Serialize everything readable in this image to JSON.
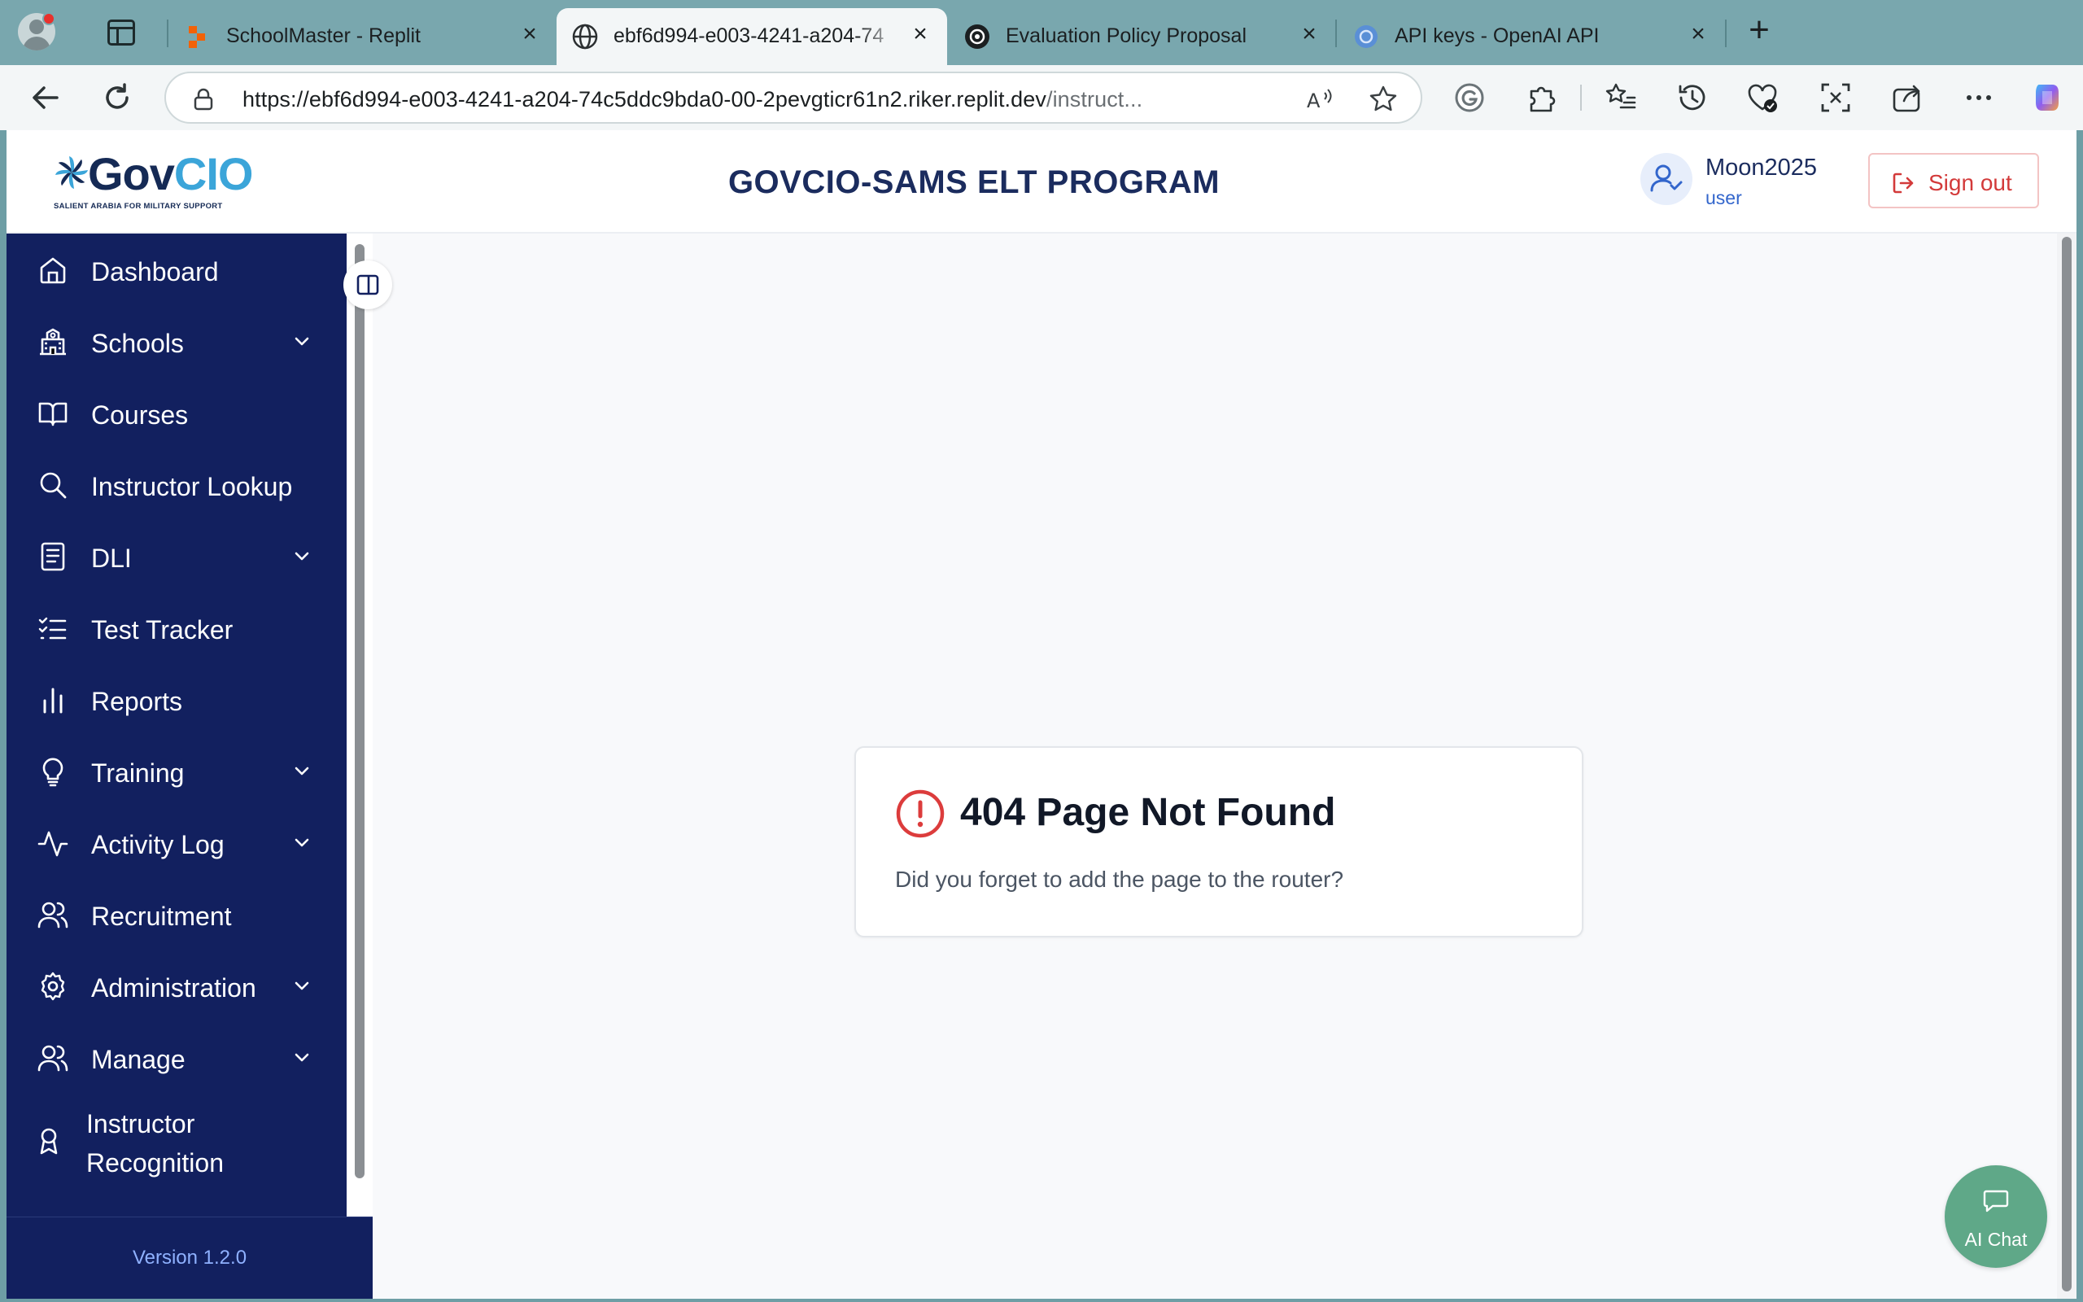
{
  "browser": {
    "tabs": [
      {
        "title": "SchoolMaster - Replit",
        "icon": "replit-icon",
        "active": false
      },
      {
        "title": "ebf6d994-e003-4241-a204-74",
        "icon": "globe-icon",
        "active": true
      },
      {
        "title": "Evaluation Policy Proposal",
        "icon": "openai-icon",
        "active": false
      },
      {
        "title": "API keys - OpenAI API",
        "icon": "openai-api-icon",
        "active": false
      }
    ],
    "url_host": "https://ebf6d994-e003-4241-a204-74c5ddc9bda0-00-2pevgticr61n2.riker.replit.dev",
    "url_path": "/instruct..."
  },
  "header": {
    "logo": "GovCIO",
    "logo_word_1": "Gov",
    "logo_word_2": "CIO",
    "logo_tagline": "SALIENT ARABIA FOR MILITARY SUPPORT",
    "app_title": "GOVCIO-SAMS ELT PROGRAM",
    "user_name": "Moon2025",
    "user_role": "user",
    "signout_label": "Sign out"
  },
  "sidebar": {
    "items": [
      {
        "label": "Dashboard",
        "icon": "home-icon",
        "expandable": false
      },
      {
        "label": "Schools",
        "icon": "school-icon",
        "expandable": true
      },
      {
        "label": "Courses",
        "icon": "book-open-icon",
        "expandable": false
      },
      {
        "label": "Instructor Lookup",
        "icon": "search-icon",
        "expandable": false
      },
      {
        "label": "DLI",
        "icon": "notebook-icon",
        "expandable": true
      },
      {
        "label": "Test Tracker",
        "icon": "checklist-icon",
        "expandable": false
      },
      {
        "label": "Reports",
        "icon": "bar-chart-icon",
        "expandable": false
      },
      {
        "label": "Training",
        "icon": "lightbulb-icon",
        "expandable": true
      },
      {
        "label": "Activity Log",
        "icon": "activity-icon",
        "expandable": true
      },
      {
        "label": "Recruitment",
        "icon": "users-icon",
        "expandable": false
      },
      {
        "label": "Administration",
        "icon": "gear-icon",
        "expandable": true
      },
      {
        "label": "Manage",
        "icon": "users-icon",
        "expandable": true
      },
      {
        "label": "Instructor Recognition",
        "icon": "award-icon",
        "expandable": false
      }
    ],
    "version": "Version 1.2.0"
  },
  "main": {
    "error_title": "404 Page Not Found",
    "error_message": "Did you forget to add the page to the router?"
  },
  "ai_chat_label": "AI Chat",
  "colors": {
    "sidebar_bg": "#12205f",
    "title_color": "#1b2c5e",
    "signout_red": "#d33a3a",
    "error_red": "#dc3c3c",
    "ai_chat_green": "#5fa888"
  }
}
